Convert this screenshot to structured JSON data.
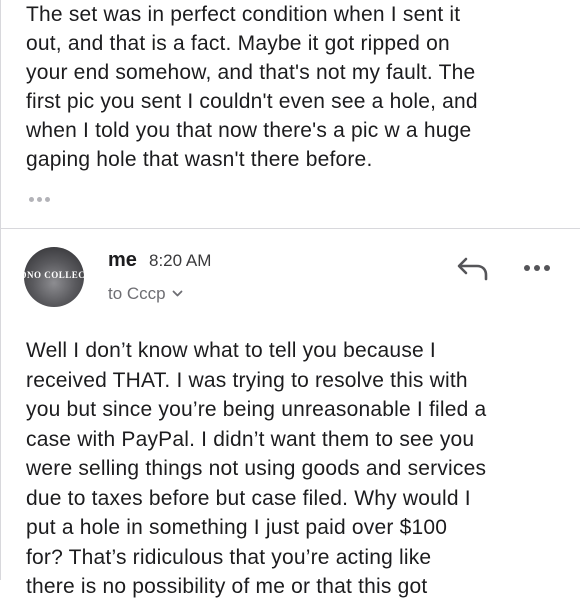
{
  "previous_message": {
    "lines": [
      "The set was in perfect condition when I sent it",
      "out, and that is a fact. Maybe it got ripped on",
      "your end somehow, and that's not my fault. The",
      "first pic you sent I couldn't even see a hole, and",
      "when I told you that now there's a pic w a huge",
      "gaping hole that wasn't there before."
    ]
  },
  "message": {
    "sender": "me",
    "time": "8:20 AM",
    "recipient": "to Cccp",
    "avatar_text": "DNO COLLECTIV",
    "body_lines": [
      "Well I don’t know what to tell you because I",
      "received THAT. I was trying to resolve this with",
      "you but since you’re being unreasonable I filed a",
      "case with PayPal. I didn’t want them to see you",
      "were selling things not using goods and services",
      "due to taxes before but case filed. Why would I",
      "put a hole in something I just paid over $100",
      "for? That’s ridiculous that you’re acting like",
      "there is no possibility of me or that this got"
    ]
  },
  "icons": {
    "reply": "reply-arrow-icon",
    "more": "more-horizontal-icon",
    "expand": "chevron-down-icon",
    "trimmed_content": "ellipsis-icon"
  },
  "colors": {
    "text": "#1c1c1e",
    "secondary": "#6e6e73",
    "icon": "#555559",
    "divider": "#d8d8dc"
  }
}
